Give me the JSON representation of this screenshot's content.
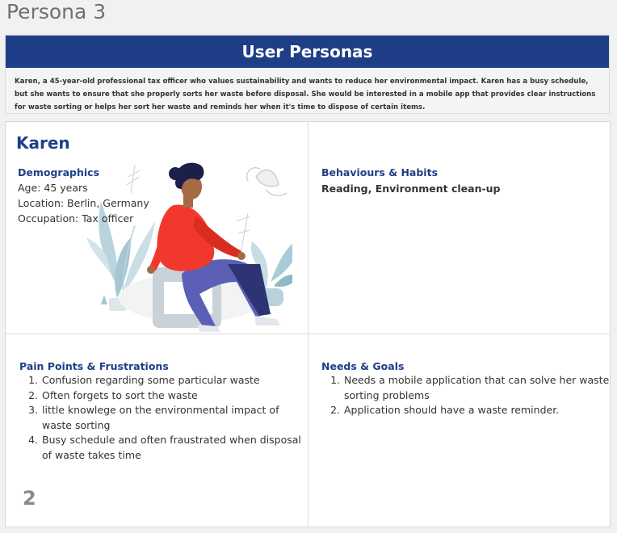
{
  "page_title": "Persona 3",
  "header": {
    "title": "User Personas",
    "description": "Karen, a 45-year-old professional tax officer who values sustainability and wants to reduce her environmental impact. Karen has a busy schedule, but she wants to ensure that she properly sorts her waste before disposal. She would be interested in a mobile app that provides clear instructions for waste sorting or helps her sort her waste and reminds her when it's time to dispose of certain items."
  },
  "persona": {
    "name": "Karen",
    "demographics": {
      "title": "Demographics",
      "age": "Age: 45 years",
      "location": "Location: Berlin, Germany",
      "occupation": "Occupation: Tax officer"
    },
    "behaviours": {
      "title": "Behaviours & Habits",
      "text": "Reading, Environment clean-up"
    },
    "pain_points": {
      "title": "Pain Points & Frustrations",
      "items": [
        "Confusion regarding some particular waste",
        "Often forgets to sort the waste",
        "little knowlege on the environmental impact of waste sorting",
        "Busy schedule and often fraustrated when disposal of waste takes time"
      ]
    },
    "needs": {
      "title": "Needs & Goals",
      "items": [
        "Needs a mobile application that can solve her waste sorting problems",
        "Application should have a waste reminder."
      ]
    }
  },
  "page_number": "2",
  "colors": {
    "accent": "#1e3f87",
    "shirt": "#f0392c",
    "pants": "#5b5fb5",
    "plants": "#a8c8d4"
  }
}
